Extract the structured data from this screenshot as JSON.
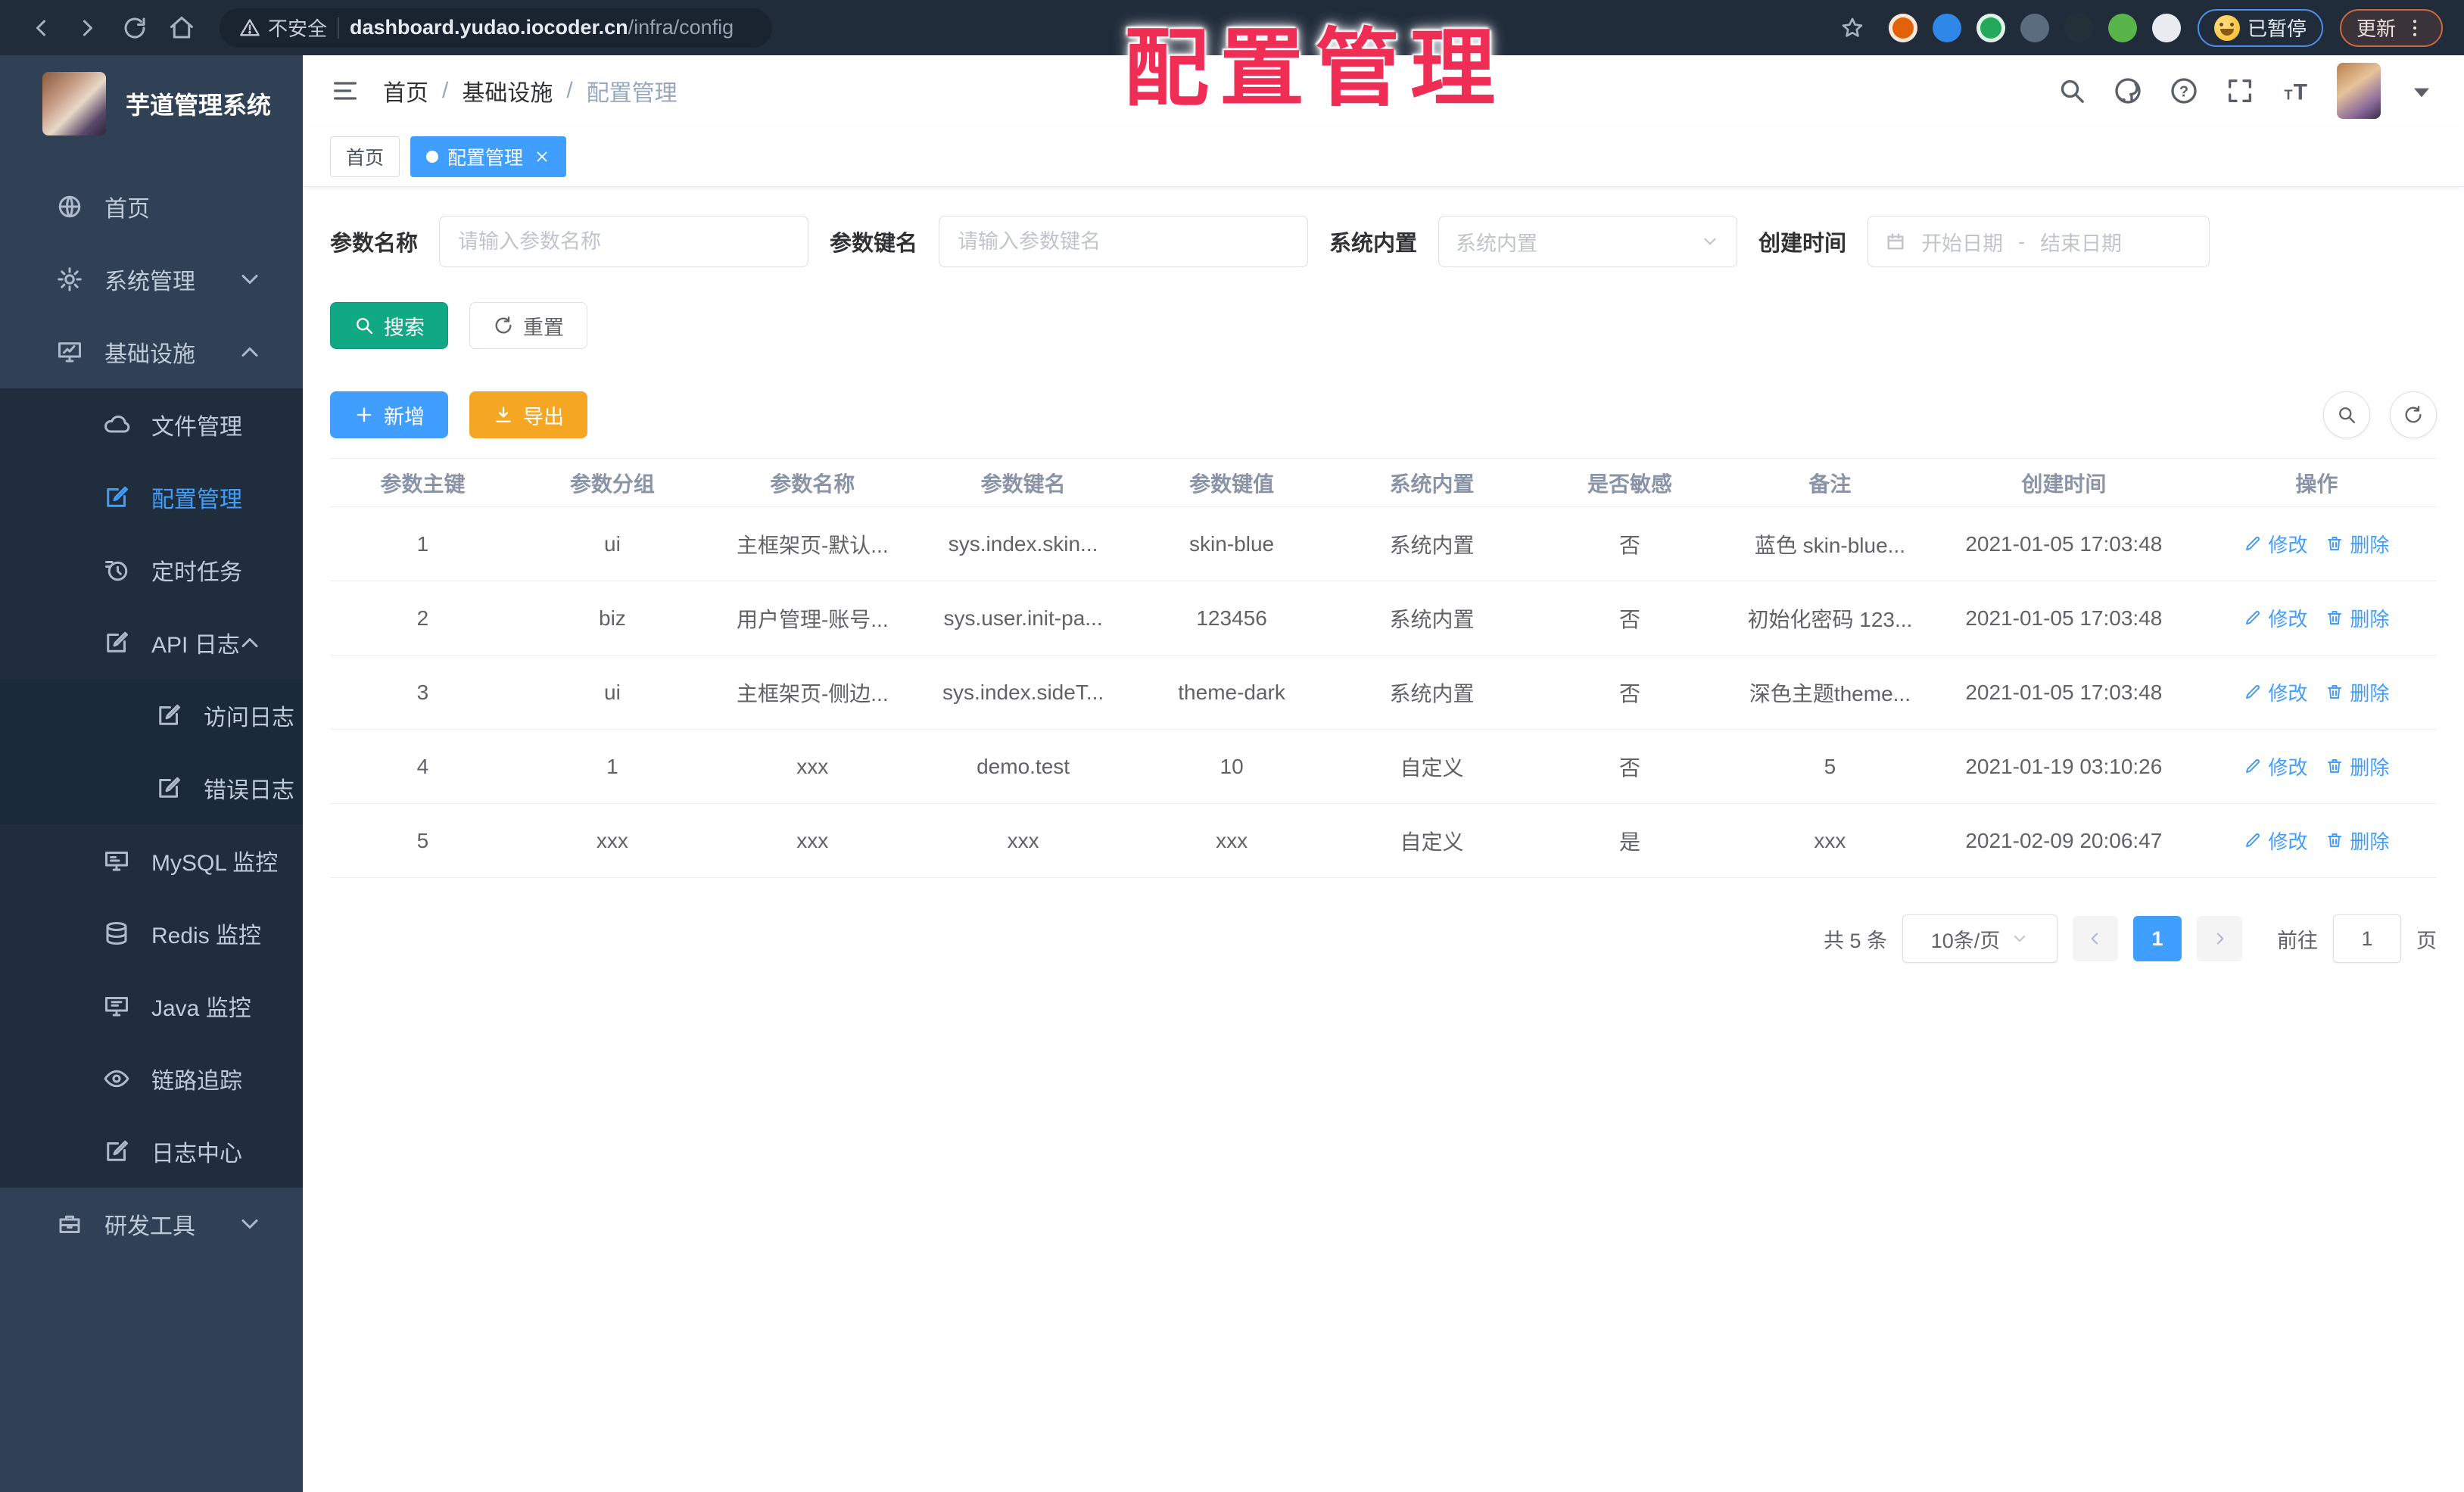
{
  "overlay": {
    "title": "配置管理"
  },
  "browser": {
    "security_label": "不安全",
    "url_host": "dashboard.yudao.iocoder.cn",
    "url_path": "/infra/config",
    "paused_label": "已暂停",
    "update_label": "更新",
    "extensions": [
      {
        "name": "extension-orange-icon",
        "color": "#E2620B",
        "ring": true
      },
      {
        "name": "extension-pin-icon",
        "color": "#2F87E8",
        "ring": false
      },
      {
        "name": "extension-green-check-icon",
        "color": "#23A85C",
        "ring": true
      },
      {
        "name": "extension-gray-icon",
        "color": "#5B6C7E",
        "ring": false
      },
      {
        "name": "extension-on-badge-icon",
        "color": "#233038",
        "ring": false
      },
      {
        "name": "extension-leaf-icon",
        "color": "#59B54A",
        "ring": false
      },
      {
        "name": "extension-puzzle-icon",
        "color": "#E9EDF2",
        "ring": false
      }
    ]
  },
  "sidebar": {
    "app_title": "芋道管理系统",
    "items": [
      {
        "label": "首页",
        "icon": "dashboard-icon",
        "level": 1
      },
      {
        "label": "系统管理",
        "icon": "gear-icon",
        "level": 1,
        "arrow": "down"
      },
      {
        "label": "基础设施",
        "icon": "infra-icon",
        "level": 1,
        "arrow": "up"
      },
      {
        "label": "文件管理",
        "icon": "cloud-icon",
        "level": 2
      },
      {
        "label": "配置管理",
        "icon": "edit-icon",
        "level": 2,
        "active": true
      },
      {
        "label": "定时任务",
        "icon": "schedule-icon",
        "level": 2
      },
      {
        "label": "API 日志",
        "icon": "log-icon",
        "level": 2,
        "arrow": "up"
      },
      {
        "label": "访问日志",
        "icon": "log-icon",
        "level": 3
      },
      {
        "label": "错误日志",
        "icon": "log-icon",
        "level": 3
      },
      {
        "label": "MySQL 监控",
        "icon": "mysql-icon",
        "level": 2
      },
      {
        "label": "Redis 监控",
        "icon": "redis-icon",
        "level": 2
      },
      {
        "label": "Java 监控",
        "icon": "java-icon",
        "level": 2
      },
      {
        "label": "链路追踪",
        "icon": "eye-icon",
        "level": 2
      },
      {
        "label": "日志中心",
        "icon": "log-icon",
        "level": 2
      },
      {
        "label": "研发工具",
        "icon": "toolbox-icon",
        "level": 1,
        "arrow": "down"
      }
    ]
  },
  "header": {
    "breadcrumb": [
      "首页",
      "基础设施",
      "配置管理"
    ]
  },
  "tags": {
    "home_label": "首页",
    "active_label": "配置管理"
  },
  "filters": {
    "name_label": "参数名称",
    "name_placeholder": "请输入参数名称",
    "key_label": "参数键名",
    "key_placeholder": "请输入参数键名",
    "builtin_label": "系统内置",
    "builtin_placeholder": "系统内置",
    "time_label": "创建时间",
    "date_start": "开始日期",
    "date_separator": "-",
    "date_end": "结束日期"
  },
  "actions": {
    "search_label": "搜索",
    "reset_label": "重置",
    "add_label": "新增",
    "export_label": "导出"
  },
  "table": {
    "columns": [
      "参数主键",
      "参数分组",
      "参数名称",
      "参数键名",
      "参数键值",
      "系统内置",
      "是否敏感",
      "备注",
      "创建时间",
      "操作"
    ],
    "edit_label": "修改",
    "delete_label": "删除",
    "rows": [
      {
        "cells": [
          "1",
          "ui",
          "主框架页-默认...",
          "sys.index.skin...",
          "skin-blue",
          "系统内置",
          "否",
          "蓝色 skin-blue...",
          "2021-01-05 17:03:48"
        ]
      },
      {
        "cells": [
          "2",
          "biz",
          "用户管理-账号...",
          "sys.user.init-pa...",
          "123456",
          "系统内置",
          "否",
          "初始化密码 123...",
          "2021-01-05 17:03:48"
        ]
      },
      {
        "cells": [
          "3",
          "ui",
          "主框架页-侧边...",
          "sys.index.sideT...",
          "theme-dark",
          "系统内置",
          "否",
          "深色主题theme...",
          "2021-01-05 17:03:48"
        ]
      },
      {
        "cells": [
          "4",
          "1",
          "xxx",
          "demo.test",
          "10",
          "自定义",
          "否",
          "5",
          "2021-01-19 03:10:26"
        ]
      },
      {
        "cells": [
          "5",
          "xxx",
          "xxx",
          "xxx",
          "xxx",
          "自定义",
          "是",
          "xxx",
          "2021-02-09 20:06:47"
        ]
      }
    ]
  },
  "pagination": {
    "total": "共 5 条",
    "page_size": "10条/页",
    "page": "1",
    "goto_label": "前往",
    "goto_value": "1",
    "unit_label": "页"
  }
}
